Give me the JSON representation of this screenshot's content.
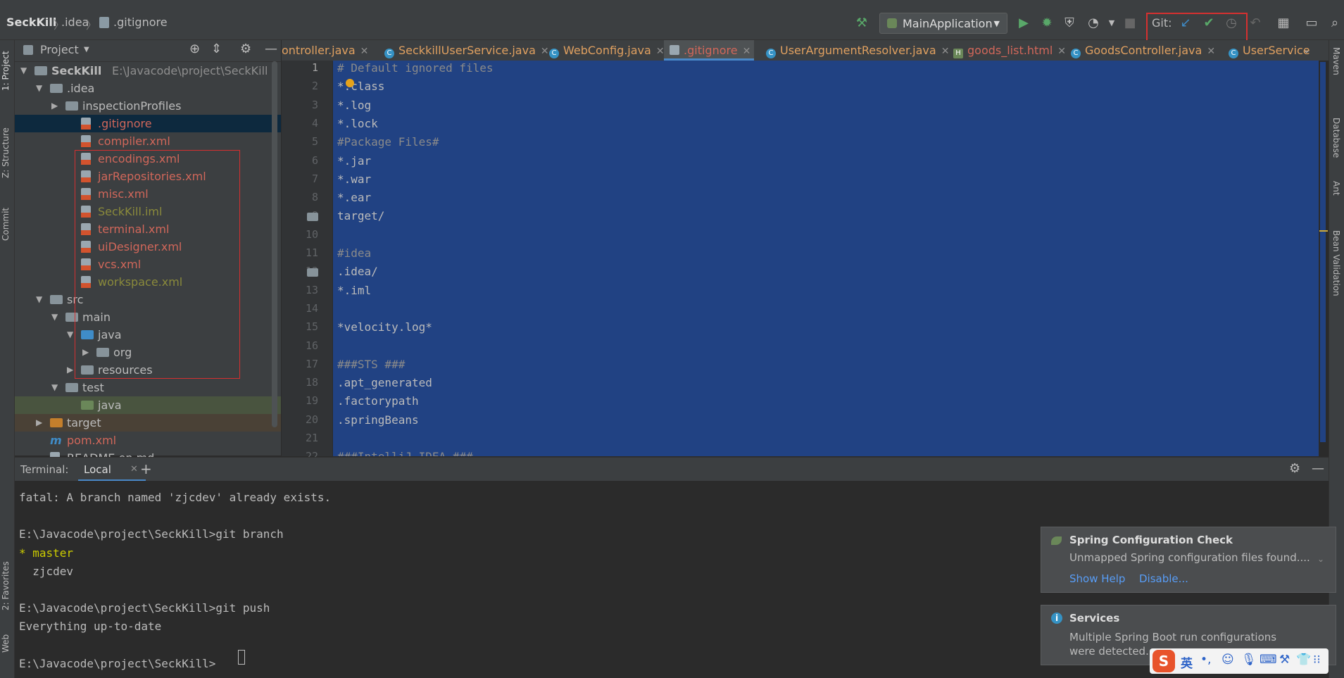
{
  "navbar": {
    "crumbs": [
      "SeckKill",
      ".idea",
      ".gitignore"
    ],
    "run_config": "MainApplication",
    "git_label": "Git:"
  },
  "left_stripe": {
    "project": "1: Project",
    "structure": "Z: Structure",
    "commit": "Commit",
    "favorites": "2: Favorites",
    "web": "Web"
  },
  "right_stripe": {
    "maven": "Maven",
    "database": "Database",
    "ant": "Ant",
    "bean": "Bean Validation"
  },
  "project_panel": {
    "title": "Project",
    "tree": [
      {
        "label": "SeckKill",
        "extra": "E:\\Javacode\\project\\SeckKill",
        "indent": 0,
        "arrow": "▼",
        "kind": "folder",
        "color": "#bbbbbb"
      },
      {
        "label": ".idea",
        "indent": 1,
        "arrow": "▼",
        "kind": "folder",
        "color": "#bbbbbb"
      },
      {
        "label": "inspectionProfiles",
        "indent": 2,
        "arrow": "▶",
        "kind": "folder",
        "color": "#bbbbbb"
      },
      {
        "label": ".gitignore",
        "indent": 3,
        "kind": "file",
        "color": "#d1675a",
        "selected": true
      },
      {
        "label": "compiler.xml",
        "indent": 3,
        "kind": "xml",
        "color": "#d1675a"
      },
      {
        "label": "encodings.xml",
        "indent": 3,
        "kind": "xml",
        "color": "#d1675a"
      },
      {
        "label": "jarRepositories.xml",
        "indent": 3,
        "kind": "xml",
        "color": "#d1675a"
      },
      {
        "label": "misc.xml",
        "indent": 3,
        "kind": "xml",
        "color": "#d1675a"
      },
      {
        "label": "SeckKill.iml",
        "indent": 3,
        "kind": "iml",
        "color": "#8a8a3b"
      },
      {
        "label": "terminal.xml",
        "indent": 3,
        "kind": "xml",
        "color": "#d1675a"
      },
      {
        "label": "uiDesigner.xml",
        "indent": 3,
        "kind": "xml",
        "color": "#d1675a"
      },
      {
        "label": "vcs.xml",
        "indent": 3,
        "kind": "xml",
        "color": "#d1675a"
      },
      {
        "label": "workspace.xml",
        "indent": 3,
        "kind": "xml",
        "color": "#8a8a3b"
      },
      {
        "label": "src",
        "indent": 1,
        "arrow": "▼",
        "kind": "folder",
        "color": "#bbbbbb"
      },
      {
        "label": "main",
        "indent": 2,
        "arrow": "▼",
        "kind": "folder",
        "color": "#bbbbbb"
      },
      {
        "label": "java",
        "indent": 3,
        "arrow": "▼",
        "kind": "folder-blue",
        "color": "#bbbbbb"
      },
      {
        "label": "org",
        "indent": 4,
        "arrow": "▶",
        "kind": "folder",
        "color": "#bbbbbb"
      },
      {
        "label": "resources",
        "indent": 3,
        "arrow": "▶",
        "kind": "folder",
        "color": "#bbbbbb"
      },
      {
        "label": "test",
        "indent": 2,
        "arrow": "▼",
        "kind": "folder",
        "color": "#bbbbbb"
      },
      {
        "label": "java",
        "indent": 3,
        "kind": "folder-green",
        "color": "#bbbbbb",
        "strip": "test"
      },
      {
        "label": "target",
        "indent": 1,
        "arrow": "▶",
        "kind": "folder-orange",
        "color": "#bbbbbb",
        "strip": "target"
      },
      {
        "label": "pom.xml",
        "indent": 1,
        "kind": "maven",
        "color": "#d1675a"
      },
      {
        "label": "README.en.md",
        "indent": 1,
        "kind": "file",
        "color": "#bbbbbb"
      }
    ]
  },
  "tabs": [
    {
      "label": "ontroller.java",
      "icon": "c",
      "active": false
    },
    {
      "label": "SeckkillUserService.java",
      "icon": "c",
      "active": false
    },
    {
      "label": "WebConfig.java",
      "icon": "c",
      "active": false
    },
    {
      "label": ".gitignore",
      "icon": "git",
      "active": true
    },
    {
      "label": "UserArgumentResolver.java",
      "icon": "c",
      "active": false
    },
    {
      "label": "goods_list.html",
      "icon": "html",
      "active": false
    },
    {
      "label": "GoodsController.java",
      "icon": "c",
      "active": false
    },
    {
      "label": "UserService",
      "icon": "c",
      "active": false
    }
  ],
  "editor": {
    "lines": [
      {
        "n": "1",
        "text": "# Default ignored files",
        "comment": true
      },
      {
        "n": "2",
        "text": "*.class"
      },
      {
        "n": "3",
        "text": "*.log"
      },
      {
        "n": "4",
        "text": "*.lock"
      },
      {
        "n": "5",
        "text": "#Package Files#",
        "comment": true
      },
      {
        "n": "6",
        "text": "*.jar"
      },
      {
        "n": "7",
        "text": "*.war"
      },
      {
        "n": "8",
        "text": "*.ear"
      },
      {
        "n": "9",
        "text": "target/"
      },
      {
        "n": "10",
        "text": ""
      },
      {
        "n": "11",
        "text": "#idea",
        "comment": true
      },
      {
        "n": "12",
        "text": ".idea/"
      },
      {
        "n": "13",
        "text": "*.iml"
      },
      {
        "n": "14",
        "text": ""
      },
      {
        "n": "15",
        "text": "*velocity.log*"
      },
      {
        "n": "16",
        "text": ""
      },
      {
        "n": "17",
        "text": "###STS ###",
        "comment": true
      },
      {
        "n": "18",
        "text": ".apt_generated"
      },
      {
        "n": "19",
        "text": ".factorypath"
      },
      {
        "n": "20",
        "text": ".springBeans"
      },
      {
        "n": "21",
        "text": ""
      },
      {
        "n": "22",
        "text": "###IntelliJ IDEA ###",
        "comment": true
      }
    ]
  },
  "terminal": {
    "title": "Terminal:",
    "tab": "Local",
    "lines": [
      {
        "text": "fatal: A branch named 'zjcdev' already exists.",
        "style": ""
      },
      {
        "text": "",
        "style": ""
      },
      {
        "text": "E:\\Javacode\\project\\SeckKill>git branch",
        "style": ""
      },
      {
        "text": "* master",
        "style": "yellow"
      },
      {
        "text": "  zjcdev",
        "style": ""
      },
      {
        "text": "",
        "style": ""
      },
      {
        "text": "E:\\Javacode\\project\\SeckKill>git push",
        "style": ""
      },
      {
        "text": "Everything up-to-date",
        "style": ""
      },
      {
        "text": "",
        "style": ""
      },
      {
        "text": "E:\\Javacode\\project\\SeckKill>",
        "style": ""
      }
    ]
  },
  "notifications": {
    "spring": {
      "title": "Spring Configuration Check",
      "body": "Unmapped Spring configuration files found....",
      "link1": "Show Help",
      "link2": "Disable..."
    },
    "services": {
      "title": "Services",
      "body1": "Multiple Spring Boot run configurations",
      "body2": "were detected...."
    }
  },
  "ime": {
    "lang": "英"
  }
}
